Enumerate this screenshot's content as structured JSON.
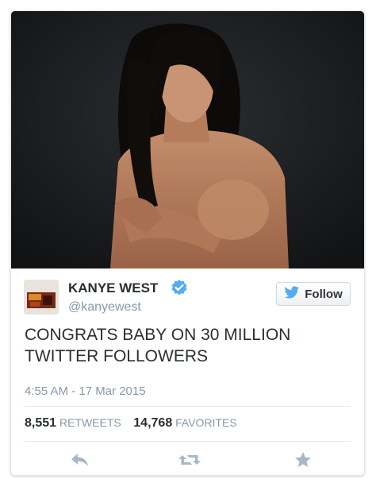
{
  "tweet": {
    "author_name": "KANYE WEST",
    "author_handle": "@kanyewest",
    "follow_label": "Follow",
    "text": "CONGRATS BABY ON 30 MILLION TWITTER FOLLOWERS",
    "timestamp": "4:55 AM - 17 Mar 2015",
    "retweet_count": "8,551",
    "retweet_label": "RETWEETS",
    "favorite_count": "14,768",
    "favorite_label": "FAVORITES"
  },
  "icons": {
    "verified": "verified-badge-icon",
    "bird": "twitter-bird-icon",
    "reply": "reply-icon",
    "retweet": "retweet-icon",
    "favorite": "star-icon"
  },
  "colors": {
    "verified_blue": "#55acee",
    "bird_blue": "#55acee",
    "action_gray": "#aab8c2"
  }
}
